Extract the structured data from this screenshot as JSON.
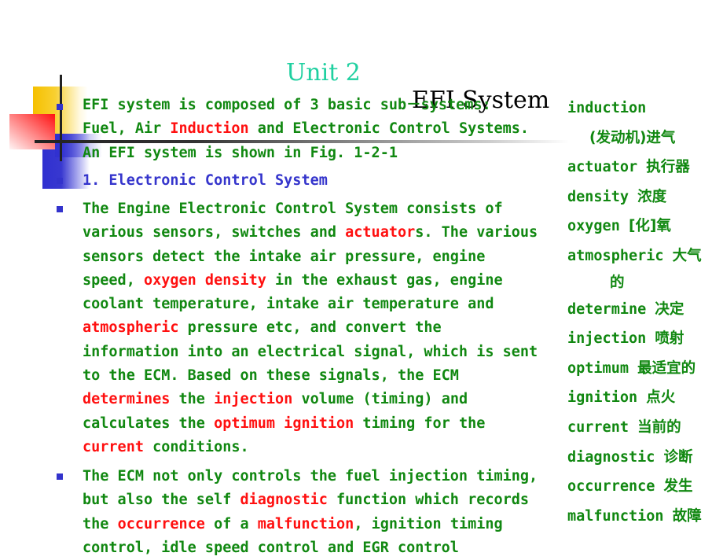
{
  "title": {
    "unit": "Unit 2",
    "name": "EFI System"
  },
  "colors": {
    "unit_title": "#1fd0a0",
    "body_text": "#118811",
    "highlight": "#ff1010",
    "heading": "#3535cc",
    "bullet": "#3333cc"
  },
  "paragraphs": [
    {
      "lines": [
        [
          {
            "t": "EFI system is composed of 3 basic sub－systems:"
          }
        ],
        [
          {
            "t": "Fuel, Air "
          },
          {
            "t": "Induction",
            "hl": true
          },
          {
            "t": " and Electronic Control Systems."
          }
        ],
        [
          {
            "t": "An EFI system is shown in Fig. 1-2-1"
          }
        ]
      ]
    },
    {
      "heading": true,
      "lines": [
        [
          {
            "t": "1. Electronic Control System"
          }
        ]
      ]
    },
    {
      "lines": [
        [
          {
            "t": "The Engine Electronic Control System consists of"
          }
        ],
        [
          {
            "t": "various sensors, switches and "
          },
          {
            "t": "actuator",
            "hl": true
          },
          {
            "t": "s. The various"
          }
        ],
        [
          {
            "t": "sensors detect the intake air pressure, engine"
          }
        ],
        [
          {
            "t": "speed, "
          },
          {
            "t": "oxygen density",
            "hl": true
          },
          {
            "t": " in the exhaust gas, engine"
          }
        ],
        [
          {
            "t": "coolant temperature, intake air temperature and"
          }
        ],
        [
          {
            "t": "atmospheric",
            "hl": true
          },
          {
            "t": " pressure etc, and convert the"
          }
        ],
        [
          {
            "t": "information into an electrical signal, which is sent"
          }
        ],
        [
          {
            "t": "to the ECM. Based on these signals, the ECM"
          }
        ],
        [
          {
            "t": "determines",
            "hl": true
          },
          {
            "t": " the "
          },
          {
            "t": "injection",
            "hl": true
          },
          {
            "t": " volume (timing) and"
          }
        ],
        [
          {
            "t": "calculates the "
          },
          {
            "t": "optimum ignition",
            "hl": true
          },
          {
            "t": " timing for the"
          }
        ],
        [
          {
            "t": "current",
            "hl": true
          },
          {
            "t": " conditions."
          }
        ]
      ]
    },
    {
      "lines": [
        [
          {
            "t": "The ECM not only controls the fuel injection timing,"
          }
        ],
        [
          {
            "t": "but also the self "
          },
          {
            "t": "diagnostic",
            "hl": true
          },
          {
            "t": " function which records"
          }
        ],
        [
          {
            "t": "the "
          },
          {
            "t": "occurrence",
            "hl": true
          },
          {
            "t": " of a "
          },
          {
            "t": "malfunction",
            "hl": true
          },
          {
            "t": ", ignition timing"
          }
        ],
        [
          {
            "t": "control, idle speed control and EGR control"
          }
        ]
      ]
    }
  ],
  "glossary": [
    {
      "en": "induction",
      "zh": ""
    },
    {
      "en": "",
      "zh": "(发动机)进气",
      "sub": true
    },
    {
      "en": "actuator",
      "zh": "执行器"
    },
    {
      "en": "density",
      "zh": "浓度"
    },
    {
      "en": "oxygen",
      "zh": "[化]氧"
    },
    {
      "en": "atmospheric",
      "zh": "大气"
    },
    {
      "en": "",
      "zh": "的",
      "sub2": true
    },
    {
      "en": "determine",
      "zh": "决定"
    },
    {
      "en": "injection",
      "zh": "喷射"
    },
    {
      "en": "optimum",
      "zh": "最适宜的"
    },
    {
      "en": "ignition",
      "zh": "点火"
    },
    {
      "en": "current",
      "zh": "当前的"
    },
    {
      "en": "diagnostic",
      "zh": "诊断"
    },
    {
      "en": "occurrence",
      "zh": "发生"
    },
    {
      "en": "malfunction",
      "zh": "故障"
    }
  ]
}
